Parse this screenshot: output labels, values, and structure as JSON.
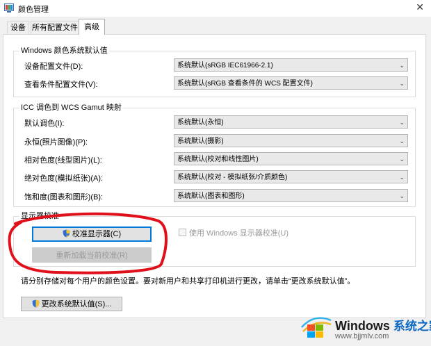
{
  "window": {
    "title": "颜色管理",
    "close_glyph": "✕"
  },
  "tabs": [
    {
      "label": "设备",
      "active": false
    },
    {
      "label": "所有配置文件",
      "active": false
    },
    {
      "label": "高级",
      "active": true
    }
  ],
  "windows_defaults": {
    "legend": "Windows 颜色系统默认值",
    "rows": [
      {
        "label": "设备配置文件(D):",
        "value": "系统默认(sRGB IEC61966-2.1)"
      },
      {
        "label": "查看条件配置文件(V):",
        "value": "系统默认(sRGB 查看条件的 WCS 配置文件)"
      }
    ]
  },
  "icc_mapping": {
    "legend": "ICC 调色到 WCS Gamut 映射",
    "rows": [
      {
        "label": "默认调色(I):",
        "value": "系统默认(永恒)"
      },
      {
        "label": "永恒(照片图像)(P):",
        "value": "系统默认(摄影)"
      },
      {
        "label": "相对色度(线型图片)(L):",
        "value": "系统默认(校对和线性图片)"
      },
      {
        "label": "绝对色度(模拟纸张)(A):",
        "value": "系统默认(校对 - 模拟纸张/介质颜色)"
      },
      {
        "label": "饱和度(图表和图形)(B):",
        "value": "系统默认(图表和图形)"
      }
    ]
  },
  "calibration": {
    "legend": "显示器校准",
    "calibrate_button": "校准显示器(C)",
    "reload_button": "重新加载当前校准(R)",
    "use_windows_calibration": {
      "label": "使用 Windows 显示器校准(U)",
      "checked": false,
      "enabled": false
    }
  },
  "footer": {
    "note": "请分别存储对每个用户的颜色设置。要对新用户和共享打印机进行更改，请单击“更改系统默认值”。",
    "change_defaults_button": "更改系统默认值(S)..."
  },
  "dropdown_icon": "chevron-down-icon",
  "annotation": {
    "color": "#e0101a"
  },
  "watermark": {
    "brand": "Windows",
    "brand_cn": "系统之家",
    "url": "www.bjjmlv.com"
  }
}
